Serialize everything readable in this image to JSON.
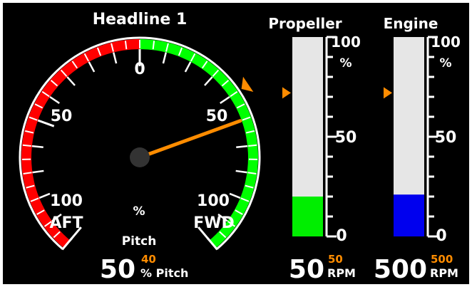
{
  "headline": "Headline 1",
  "pitch_gauge": {
    "scale_labels": {
      "zero": "0",
      "aft_mid": "50",
      "fwd_mid": "50",
      "aft_end": "100",
      "fwd_end": "100"
    },
    "aft_label": "AFT",
    "fwd_label": "FWD",
    "unit_label": "%",
    "caption": "Pitch",
    "pointer_value": 50,
    "setpoint_value": 40,
    "readout": {
      "value": "50",
      "setpoint": "40",
      "unit": "% Pitch"
    },
    "colors": {
      "aft_band": "#ff0000",
      "fwd_band": "#00ff00",
      "pointer": "#ff8c00",
      "setpoint_marker": "#ff8c00",
      "hub": "#333333"
    }
  },
  "propeller": {
    "title": "Propeller",
    "scale_max": "100",
    "scale_mid": "50",
    "scale_min": "0",
    "unit_label": "%",
    "fill_fraction": 0.2,
    "setpoint_fraction": 0.72,
    "readout": {
      "value": "50",
      "setpoint": "50",
      "unit": "RPM"
    },
    "colors": {
      "fill": "#00ee00",
      "track": "#e6e6e6",
      "marker": "#ff8c00"
    }
  },
  "engine": {
    "title": "Engine",
    "scale_max": "100",
    "scale_mid": "50",
    "scale_min": "0",
    "unit_label": "%",
    "fill_fraction": 0.21,
    "setpoint_fraction": 0.72,
    "readout": {
      "value": "500",
      "setpoint": "500",
      "unit": "RPM"
    },
    "colors": {
      "fill": "#0000ee",
      "track": "#e6e6e6",
      "marker": "#ff8c00"
    }
  }
}
